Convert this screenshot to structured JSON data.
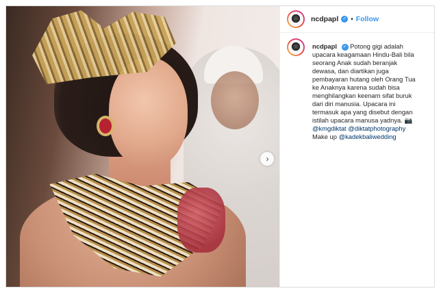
{
  "post": {
    "username": "ncdpapl",
    "follow_label": "Follow",
    "separator": "•",
    "verified_mark": "✓",
    "caption_lines": [
      "Potong gigi adalah",
      "upacara keagamaan Hindu-Bali bila",
      "seorang Anak sudah beranjak",
      "dewasa, dan diartikan juga",
      "pembayaran hutang oleh Orang Tua",
      "ke Anaknya karena sudah bisa",
      "menghilangkan keenam sifat buruk",
      "dari diri manusia. Upacara ini",
      "termasuk apa yang disebut dengan",
      "istilah upacara manusa yadnya. 📷"
    ],
    "mention_1": "@kmgdiktat",
    "mention_2": "@diktatphotography",
    "makeup_prefix": "Make up",
    "mention_3": "@kadekbaliwedding",
    "carousel_next_glyph": "›"
  },
  "colors": {
    "link": "#003569",
    "follow": "#3897f0",
    "verified": "#3897f0",
    "text": "#262626",
    "border": "#dbdbdb"
  },
  "icons": [
    "verified-badge-icon",
    "carousel-next-icon"
  ]
}
